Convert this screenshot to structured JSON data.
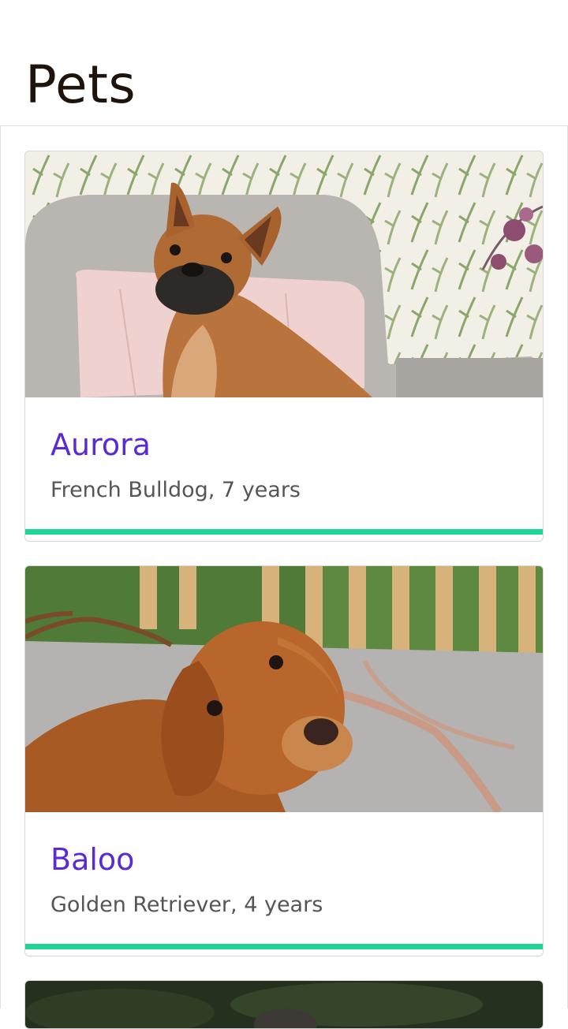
{
  "header": {
    "title": "Pets"
  },
  "theme": {
    "accent": "#1fd696",
    "name_color": "#5a2ad6"
  },
  "pets": [
    {
      "name": "Aurora",
      "detail": "French Bulldog, 7 years",
      "photo": "french-bulldog-on-armchair"
    },
    {
      "name": "Baloo",
      "detail": "Golden Retriever, 4 years",
      "photo": "golden-retriever-on-patio"
    },
    {
      "name": "",
      "detail": "",
      "photo": "dark-garden-photo"
    }
  ]
}
